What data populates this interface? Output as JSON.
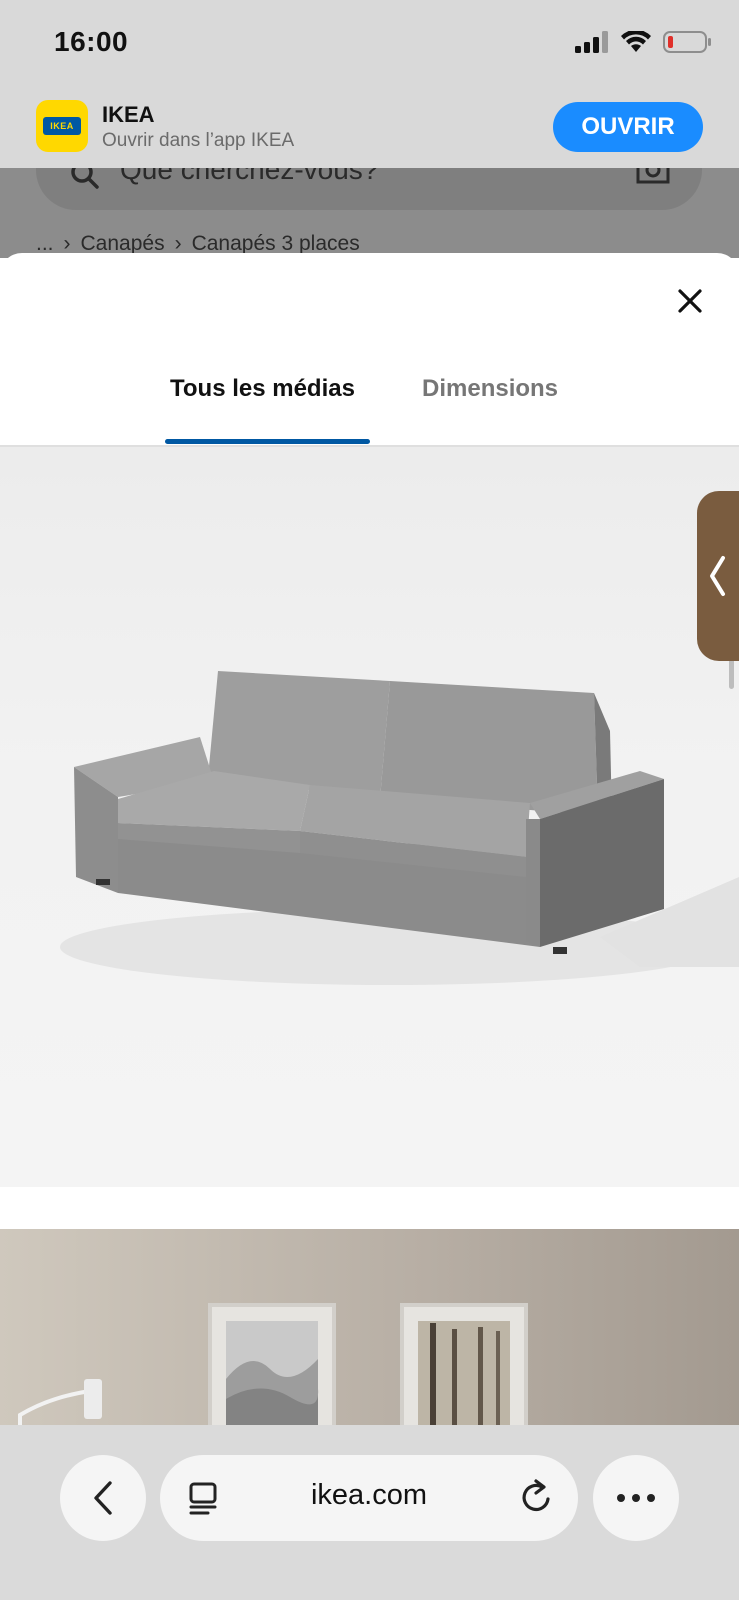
{
  "status_bar": {
    "time": "16:00"
  },
  "app_banner": {
    "icon_text": "IKEA",
    "app_name": "IKEA",
    "subtitle": "Ouvrir dans l’app IKEA",
    "open_label": "OUVRIR",
    "accent_color": "#1a8cff"
  },
  "background_page": {
    "search_placeholder": "Que cherchez-vous?",
    "breadcrumb": [
      "...",
      "Canapés",
      "Canapés 3 places"
    ]
  },
  "media_sheet": {
    "tabs": [
      {
        "label": "Tous les médias",
        "selected": true
      },
      {
        "label": "Dimensions",
        "selected": false
      }
    ],
    "accent_color": "#0058a3",
    "images": [
      {
        "subject": "grey three-seat sofa on white background"
      },
      {
        "subject": "living room with framed wall pictures and floor lamp"
      }
    ]
  },
  "browser": {
    "url": "ikea.com",
    "icons": [
      "chevron-left-icon",
      "tab-overview-icon",
      "reload-icon",
      "more-icon"
    ]
  }
}
